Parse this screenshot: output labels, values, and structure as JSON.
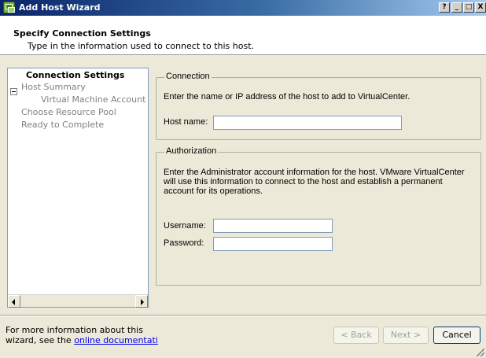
{
  "window": {
    "title": "Add Host Wizard",
    "controls": {
      "help": "?",
      "minimize": "_",
      "maximize": "□",
      "close": "X"
    }
  },
  "header": {
    "title": "Specify Connection Settings",
    "subtitle": "Type in the information used to connect to this host."
  },
  "nav": {
    "items": [
      {
        "label": "Connection Settings",
        "state": "active"
      },
      {
        "label": "Host Summary",
        "state": "inactive"
      },
      {
        "label": "Virtual Machine Account",
        "state": "inactive"
      },
      {
        "label": "Choose Resource Pool",
        "state": "inactive"
      },
      {
        "label": "Ready to Complete",
        "state": "inactive"
      }
    ]
  },
  "connection": {
    "legend": "Connection",
    "instruction": "Enter the name or IP address of the host to add to VirtualCenter.",
    "host_label": "Host name:",
    "host_value": ""
  },
  "authorization": {
    "legend": "Authorization",
    "instruction": "Enter the Administrator account information for the host. VMware VirtualCenter will use this information to connect to the host and establish a permanent account for its operations.",
    "username_label": "Username:",
    "username_value": "",
    "password_label": "Password:",
    "password_value": ""
  },
  "footer": {
    "info_prefix": "For more information about this wizard, see the",
    "link_text": "online documentati"
  },
  "buttons": {
    "back": "< Back",
    "next": "Next >",
    "cancel": "Cancel"
  }
}
